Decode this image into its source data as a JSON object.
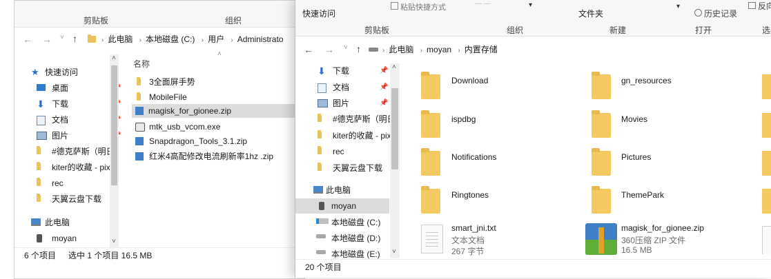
{
  "left_window": {
    "ribbon": {
      "clipboard": "剪贴板",
      "organize": "组织"
    },
    "breadcrumb": [
      "此电脑",
      "本地磁盘 (C:)",
      "用户",
      "Administrato"
    ],
    "column_name": "名称",
    "nav": [
      {
        "label": "快速访问",
        "icon": "star-icon",
        "pinned": false
      },
      {
        "label": "桌面",
        "icon": "desktop-icon",
        "pinned": true
      },
      {
        "label": "下载",
        "icon": "download-arrow-icon",
        "pinned": true
      },
      {
        "label": "文档",
        "icon": "document-icon",
        "pinned": true
      },
      {
        "label": "图片",
        "icon": "picture-icon",
        "pinned": true
      },
      {
        "label": "#德克萨斯（明日",
        "icon": "folder-icon",
        "pinned": false
      },
      {
        "label": "kiter的收藏 - pix",
        "icon": "folder-icon",
        "pinned": false
      },
      {
        "label": "rec",
        "icon": "folder-icon",
        "pinned": false
      },
      {
        "label": "天翼云盘下载",
        "icon": "folder-icon",
        "pinned": false
      },
      {
        "label": "此电脑",
        "icon": "computer-icon",
        "pinned": false
      },
      {
        "label": "moyan",
        "icon": "user-icon",
        "pinned": false
      }
    ],
    "files": [
      {
        "name": "3全面屏手势",
        "icon": "folder-icon"
      },
      {
        "name": "MobileFile",
        "icon": "folder-icon"
      },
      {
        "name": "magisk_for_gionee.zip",
        "icon": "zip-icon",
        "selected": true
      },
      {
        "name": "mtk_usb_vcom.exe",
        "icon": "exe-icon"
      },
      {
        "name": "Snapdragon_Tools_3.1.zip",
        "icon": "zip-icon"
      },
      {
        "name": "红米4高配修改电流刷新率1hz .zip",
        "icon": "zip-icon"
      }
    ],
    "status": {
      "count": "6 个项目",
      "selection": "选中 1 个项目  16.5 MB"
    }
  },
  "right_window": {
    "ribbon": {
      "quick_access": "快速访问",
      "paste_shortcut": "粘贴快捷方式",
      "folder": "文件夹",
      "history": "历史记录",
      "reverse": "反向",
      "clipboard": "剪贴板",
      "organize": "组织",
      "new": "新建",
      "open": "打开",
      "select": "选"
    },
    "breadcrumb": [
      "此电脑",
      "moyan",
      "内置存储"
    ],
    "nav": [
      {
        "label": "下载",
        "icon": "download-arrow-icon",
        "pinned": true
      },
      {
        "label": "文档",
        "icon": "document-icon",
        "pinned": true
      },
      {
        "label": "图片",
        "icon": "picture-icon",
        "pinned": true
      },
      {
        "label": "#德克萨斯（明日",
        "icon": "folder-icon",
        "pinned": false
      },
      {
        "label": "kiter的收藏 - pix",
        "icon": "folder-icon",
        "pinned": false
      },
      {
        "label": "rec",
        "icon": "folder-icon",
        "pinned": false
      },
      {
        "label": "天翼云盘下载",
        "icon": "folder-icon",
        "pinned": false
      },
      {
        "label": "此电脑",
        "icon": "computer-icon",
        "pinned": false
      },
      {
        "label": "moyan",
        "icon": "user-icon",
        "pinned": false,
        "selected": true
      },
      {
        "label": "本地磁盘 (C:)",
        "icon": "windows-drive-icon",
        "pinned": false
      },
      {
        "label": "本地磁盘 (D:)",
        "icon": "drive-icon",
        "pinned": false
      },
      {
        "label": "本地磁盘 (E:)",
        "icon": "drive-icon",
        "pinned": false
      }
    ],
    "tiles": [
      {
        "name": "Download",
        "icon": "folder-icon"
      },
      {
        "name": "gn_resources",
        "icon": "folder-icon"
      },
      {
        "name": "ispdbg",
        "icon": "folder-icon"
      },
      {
        "name": "Movies",
        "icon": "folder-icon"
      },
      {
        "name": "Notifications",
        "icon": "folder-icon"
      },
      {
        "name": "Pictures",
        "icon": "folder-icon"
      },
      {
        "name": "Ringtones",
        "icon": "folder-icon"
      },
      {
        "name": "ThemePark",
        "icon": "folder-icon"
      },
      {
        "name": "smart_jni.txt",
        "icon": "text-file-icon",
        "type": "文本文档",
        "size": "267 字节"
      },
      {
        "name": "magisk_for_gionee.zip",
        "icon": "zip-archive-icon",
        "type": "360压缩 ZIP 文件",
        "size": "16.5 MB"
      }
    ],
    "status": {
      "count": "20 个项目"
    }
  },
  "colors": {
    "folder": "#f4c962",
    "selection": "#dcdcdc",
    "accent_blue": "#2b6fd6",
    "ribbon_bg": "#f7f7f7"
  }
}
